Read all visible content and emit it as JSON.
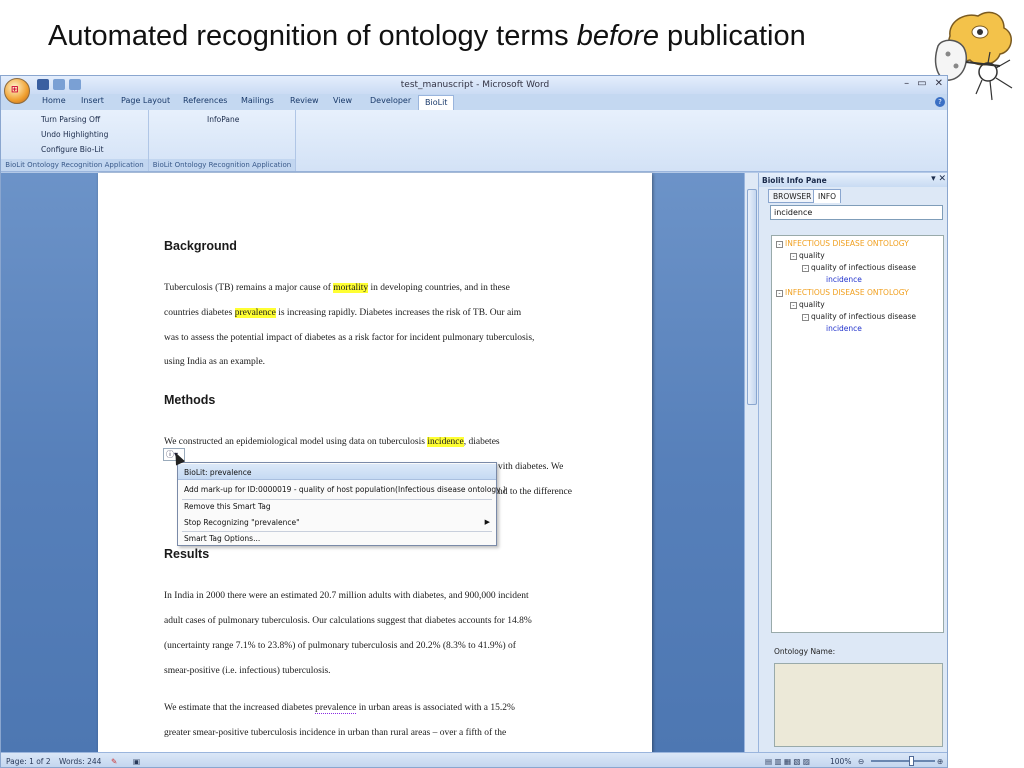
{
  "slide": {
    "title_part1": "Automated recognition of ontology terms",
    "title_italic": "before",
    "title_part2": "publication"
  },
  "window": {
    "title": "test_manuscript - Microsoft Word",
    "controls": [
      "–",
      "▭",
      "✕"
    ]
  },
  "ribbon": {
    "tabs": [
      "Home",
      "Insert",
      "Page Layout",
      "References",
      "Mailings",
      "Review",
      "View",
      "Developer",
      "BioLit"
    ],
    "active_tab": "BioLit",
    "group1": {
      "items": [
        "Turn Parsing Off",
        "Undo Highlighting",
        "Configure Bio-Lit"
      ],
      "label": "BioLit Ontology Recognition Application"
    },
    "group2": {
      "items": [
        "InfoPane"
      ],
      "label": "BioLit Ontology Recognition Application"
    }
  },
  "document": {
    "heading_background": "Background",
    "bg_p1_a": "Tuberculosis (TB) remains a major cause of",
    "bg_p1_hl": "mortality",
    "bg_p1_b": "in developing countries, and in these",
    "bg_p2_a": "countries diabetes",
    "bg_p2_hl": "prevalence",
    "bg_p2_b": "is increasing rapidly. Diabetes increases the risk of TB. Our aim",
    "bg_p3": "was to assess the potential impact of diabetes as a risk factor for incident pulmonary tuberculosis,",
    "bg_p4": "using India as an example.",
    "heading_methods": "Methods",
    "m_p1_a": "We constructed an epidemiological model using data on tuberculosis",
    "m_p1_hl": "incidence",
    "m_p1_b": ", diabetes",
    "m_p2_tail": "vith diabetes. We",
    "m_p3_tail": "nd to the difference",
    "heading_results": "Results",
    "r_p1": "In India in 2000 there were an estimated 20.7 million  adults with diabetes, and 900,000 incident",
    "r_p2": "adult cases of pulmonary tuberculosis.  Our calculations suggest that diabetes accounts for 14.8%",
    "r_p3": "(uncertainty range  7.1% to 23.8%) of pulmonary tuberculosis and 20.2% (8.3% to 41.9%) of",
    "r_p4": "smear-positive (i.e. infectious) tuberculosis.",
    "r_p5_a": "We estimate that the increased  diabetes",
    "r_p5_ul": "prevalence",
    "r_p5_b": "in urban areas is associated with a 15.2%",
    "r_p6": "greater smear-positive  tuberculosis incidence in urban than rural areas – over a fifth of the"
  },
  "smart_tag_menu": {
    "button_label": "ⓘ▾",
    "items": [
      "BioLit: prevalence",
      "Add mark-up for ID:0000019 - quality of host population(Infectious disease ontology )",
      "Remove this Smart Tag",
      "Stop Recognizing \"prevalence\"",
      "Smart Tag Options..."
    ]
  },
  "info_pane": {
    "title": "Biolit Info Pane",
    "tabs": [
      "BROWSER",
      "INFO"
    ],
    "active_tab": "INFO",
    "search_value": "incidence",
    "tree": [
      {
        "label": "INFECTIOUS DISEASE ONTOLOGY",
        "level": 0,
        "kind": "onto"
      },
      {
        "label": "quality",
        "level": 1,
        "kind": "plain"
      },
      {
        "label": "quality of infectious disease",
        "level": 2,
        "kind": "plain"
      },
      {
        "label": "incidence",
        "level": 3,
        "kind": "leaf"
      },
      {
        "label": "INFECTIOUS DISEASE ONTOLOGY",
        "level": 0,
        "kind": "onto"
      },
      {
        "label": "quality",
        "level": 1,
        "kind": "plain"
      },
      {
        "label": "quality of infectious disease",
        "level": 2,
        "kind": "plain"
      },
      {
        "label": "incidence",
        "level": 3,
        "kind": "leaf"
      }
    ],
    "ontology_name_label": "Ontology Name:"
  },
  "status": {
    "page": "Page: 1 of 2",
    "words": "Words: 244",
    "zoom": "100%"
  },
  "colors": {
    "highlight": "#ffff33",
    "ontology_text": "#f0a020",
    "leaf_text": "#2233cc",
    "doc_background": "#5780ba"
  }
}
